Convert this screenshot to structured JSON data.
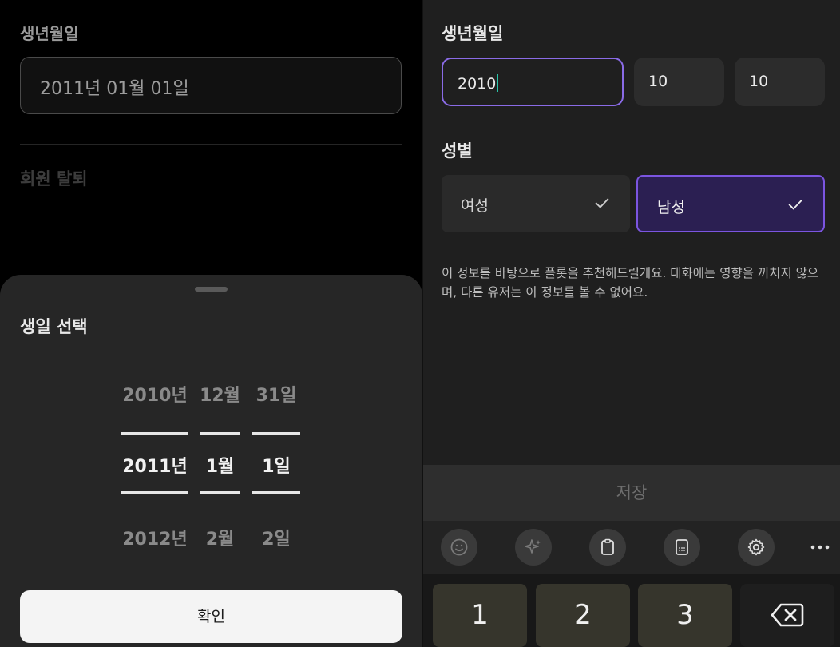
{
  "left": {
    "birth_label": "생년월일",
    "birth_value": "2011년 01월 01일",
    "withdraw_label": "회원 탈퇴",
    "sheet": {
      "title": "생일 선택",
      "year": {
        "prev": "2010년",
        "selected": "2011년",
        "next": "2012년"
      },
      "month": {
        "prev": "12월",
        "selected": "1월",
        "next": "2월"
      },
      "day": {
        "prev": "31일",
        "selected": "1일",
        "next": "2일"
      },
      "confirm_label": "확인"
    }
  },
  "right": {
    "birth_label": "생년월일",
    "year_value": "2010",
    "month_value": "10",
    "day_value": "10",
    "gender_label": "성별",
    "gender_options": [
      {
        "label": "여성",
        "selected": false
      },
      {
        "label": "남성",
        "selected": true
      }
    ],
    "notice": "이 정보를 바탕으로 플롯을 추천해드릴게요. 대화에는 영향을 끼치지 않으며, 다른 유저는 이 정보를 볼 수 없어요.",
    "save_label": "저장",
    "keyboard": {
      "toolbar_icons": [
        "emoji-icon",
        "sparkle-icon",
        "clipboard-icon",
        "keypad-icon",
        "gear-icon",
        "more-icon"
      ],
      "keys": [
        "1",
        "2",
        "3"
      ],
      "backspace_icon": "backspace-icon"
    }
  },
  "colors": {
    "accent_purple": "#7b55e0",
    "caret_teal": "#29c3a8"
  }
}
